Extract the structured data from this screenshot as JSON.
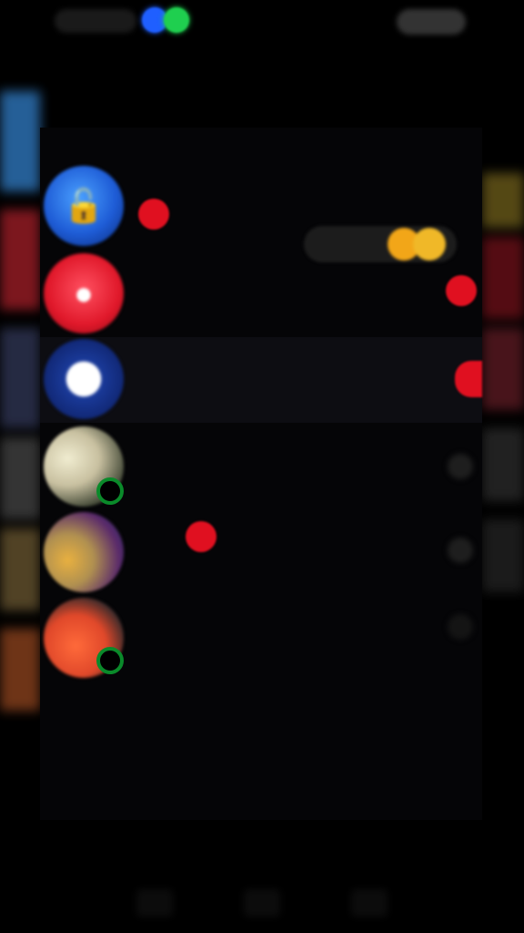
{
  "status_bar": {
    "left_icon": "status-pill-icon",
    "center_dots_colors": [
      "#1f5fff",
      "#1fcf4f"
    ],
    "right_icon": "battery-icon"
  },
  "colors": {
    "background": "#000000",
    "badge_red": "#e01020",
    "coin_gold": "#f2a618",
    "online_green": "#0a8a2a"
  },
  "notification_pill": {
    "text": "",
    "icon": "coins-icon"
  },
  "list": [
    {
      "avatar_icon": "lock-icon",
      "avatar_color": "#1e5cd6",
      "title": "",
      "subtitle": "",
      "badge": true,
      "online": false,
      "highlight": false
    },
    {
      "avatar_icon": "chat-bubble-icon",
      "avatar_color": "#e0182a",
      "title": "",
      "subtitle": "",
      "badge": true,
      "online": false,
      "highlight": false
    },
    {
      "avatar_icon": "messenger-icon",
      "avatar_color": "#1a3a9a",
      "title": "",
      "subtitle": "",
      "badge": true,
      "online": false,
      "highlight": true
    },
    {
      "avatar_icon": "profile-photo-icon",
      "avatar_color": "#c8c0a0",
      "title": "",
      "subtitle": "",
      "badge": false,
      "online": true,
      "highlight": false
    },
    {
      "avatar_icon": "group-photo-icon",
      "avatar_color": "#b09050",
      "title": "",
      "subtitle": "",
      "badge": true,
      "online": false,
      "highlight": false
    },
    {
      "avatar_icon": "profile-photo-icon",
      "avatar_color": "#e0482a",
      "title": "",
      "subtitle": "",
      "badge": false,
      "online": true,
      "highlight": false
    }
  ],
  "nav_bar": {
    "buttons": [
      "back-icon",
      "home-icon",
      "recents-icon"
    ]
  }
}
